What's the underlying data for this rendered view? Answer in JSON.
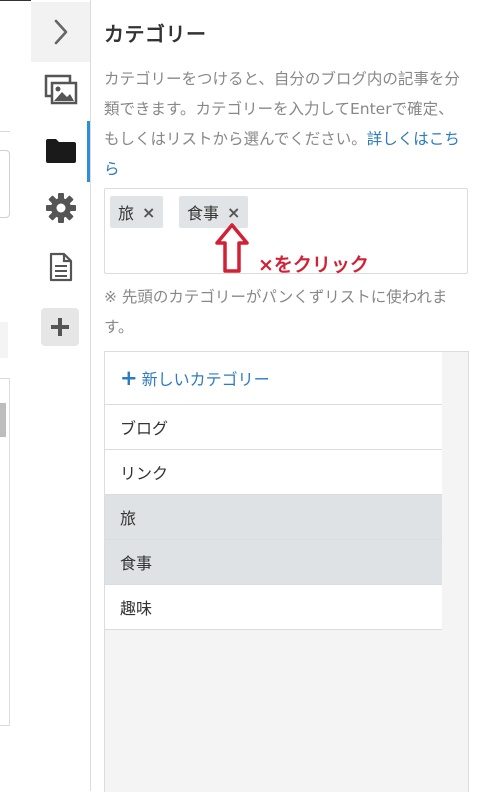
{
  "sidebar": {
    "toggle_icon": "chevron-right-icon",
    "icons": [
      "image-icon",
      "folder-icon",
      "gear-icon",
      "document-icon",
      "plus-icon"
    ],
    "active_icon": "folder-icon"
  },
  "panel": {
    "title": "カテゴリー",
    "description": "カテゴリーをつけると、自分のブログ内の記事を分類できます。カテゴリーを入力してEnterで確定、もしくはリストから選んでください。",
    "link_text": "詳しくはこちら",
    "selected_tags": [
      {
        "label": "旅",
        "remove": "×"
      },
      {
        "label": "食事",
        "remove": "×"
      }
    ],
    "note": "※ 先頭のカテゴリーがパンくずリストに使われます。",
    "list": {
      "new_plus": "+",
      "new_label": "新しいカテゴリー",
      "items": [
        {
          "label": "ブログ",
          "selected": false
        },
        {
          "label": "リンク",
          "selected": false
        },
        {
          "label": "旅",
          "selected": true
        },
        {
          "label": "食事",
          "selected": true
        },
        {
          "label": "趣味",
          "selected": false
        }
      ]
    }
  },
  "annotation": {
    "text": "×をクリック",
    "color": "#d22034"
  },
  "colors": {
    "accent": "#2d8fd5",
    "link": "#2d7bc1",
    "tag_bg": "#e1e4e6"
  }
}
